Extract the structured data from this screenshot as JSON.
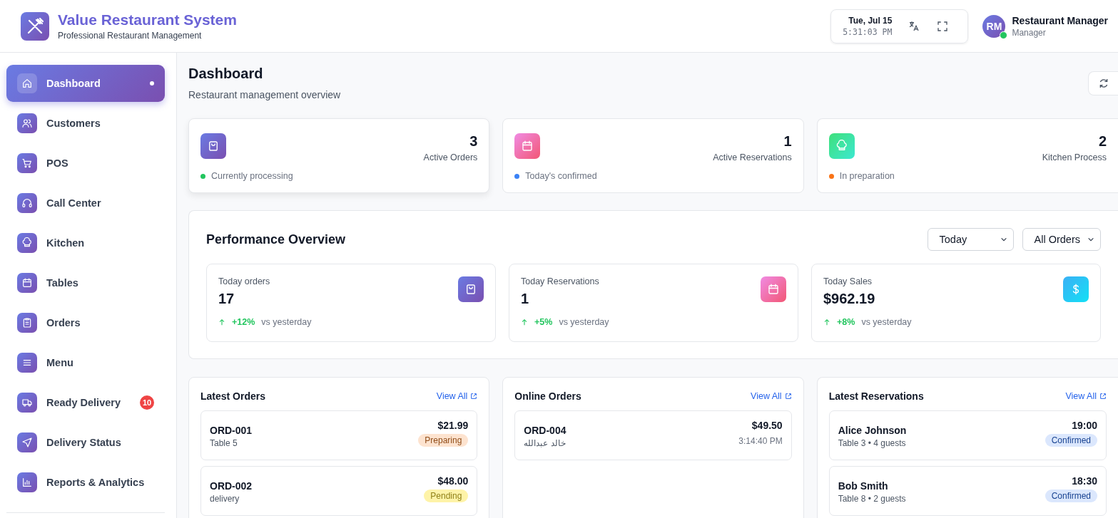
{
  "header": {
    "title": "Value Restaurant System",
    "subtitle": "Professional Restaurant Management",
    "date": "Tue, Jul 15",
    "time": "5:31:03 PM",
    "user": {
      "initials": "RM",
      "name": "Restaurant Manager",
      "role": "Manager",
      "online": true
    }
  },
  "sidebar": {
    "items": [
      {
        "label": "Dashboard",
        "selected": true
      },
      {
        "label": "Customers",
        "selected": false
      },
      {
        "label": "POS",
        "selected": false
      },
      {
        "label": "Call Center",
        "selected": false
      },
      {
        "label": "Kitchen",
        "selected": false
      },
      {
        "label": "Tables",
        "selected": false
      },
      {
        "label": "Orders",
        "selected": false
      },
      {
        "label": "Menu",
        "selected": false
      },
      {
        "label": "Ready Delivery",
        "selected": false,
        "badge": "10"
      },
      {
        "label": "Delivery Status",
        "selected": false
      },
      {
        "label": "Reports & Analytics",
        "selected": false
      }
    ]
  },
  "page": {
    "title": "Dashboard",
    "subtitle": "Restaurant management overview"
  },
  "stats": [
    {
      "value": "3",
      "label": "Active Orders",
      "note": "Currently processing",
      "color": "#22c55e"
    },
    {
      "value": "1",
      "label": "Active Reservations",
      "note": "Today's confirmed",
      "color": "#3b82f6"
    },
    {
      "value": "2",
      "label": "Kitchen Process",
      "note": "In preparation",
      "color": "#f97316"
    }
  ],
  "performance": {
    "title": "Performance Overview",
    "filters": [
      "Today",
      "All Orders"
    ],
    "cards": [
      {
        "label": "Today orders",
        "value": "17",
        "change": "+12%",
        "suffix": "vs yesterday"
      },
      {
        "label": "Today Reservations",
        "value": "1",
        "change": "+5%",
        "suffix": "vs yesterday"
      },
      {
        "label": "Today Sales",
        "value": "$962.19",
        "change": "+8%",
        "suffix": "vs yesterday"
      }
    ]
  },
  "panels": [
    {
      "title": "Latest Orders",
      "link": "View All",
      "items": [
        {
          "primary": "ORD-001",
          "secondary": "Table 5",
          "amount": "$21.99",
          "status": "Preparing",
          "kind": "badge",
          "color": "#fde3cf"
        },
        {
          "primary": "ORD-002",
          "secondary": "delivery",
          "amount": "$48.00",
          "status": "Pending",
          "kind": "badge",
          "color": "#fef3a8"
        }
      ]
    },
    {
      "title": "Online Orders",
      "link": "View All",
      "items": [
        {
          "primary": "ORD-004",
          "secondary": "خالد عبدالله",
          "amount": "$49.50",
          "status": "3:14:40 PM",
          "kind": "time"
        }
      ]
    },
    {
      "title": "Latest Reservations",
      "link": "View All",
      "items": [
        {
          "primary": "Alice Johnson",
          "secondary": "Table 3 • 4 guests",
          "amount": "19:00",
          "status": "Confirmed",
          "kind": "badge",
          "color": "#dbe7fd"
        },
        {
          "primary": "Bob Smith",
          "secondary": "Table 8 • 2 guests",
          "amount": "18:30",
          "status": "Confirmed",
          "kind": "badge",
          "color": "#dbe7fd"
        }
      ]
    }
  ]
}
